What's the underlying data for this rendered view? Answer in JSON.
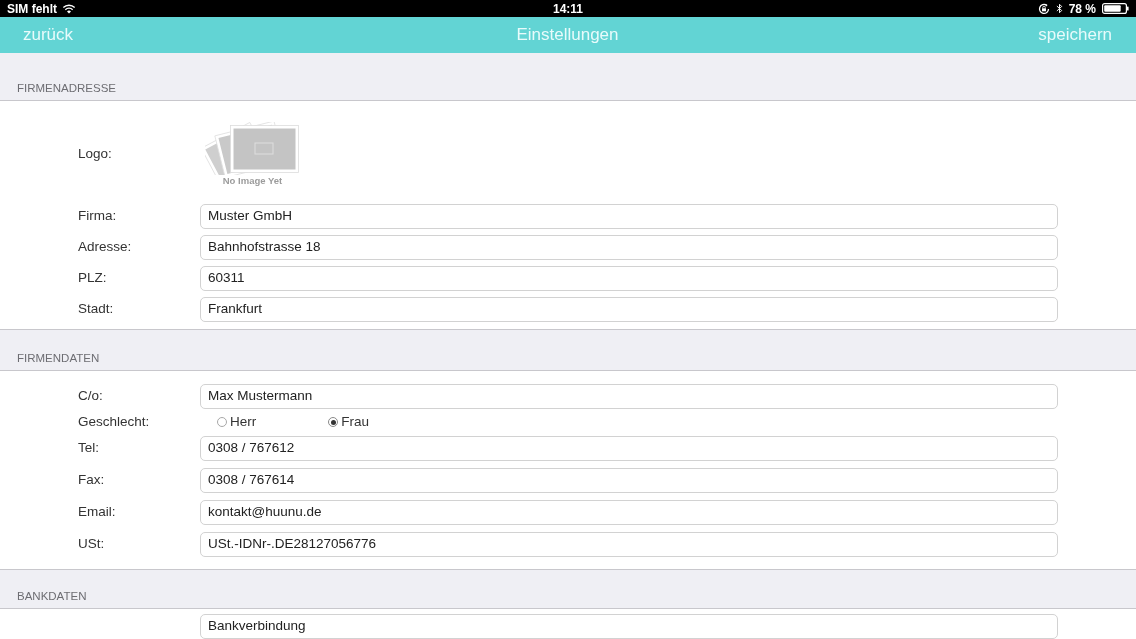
{
  "status_bar": {
    "carrier": "SIM fehlt",
    "time": "14:11",
    "battery": "78 %"
  },
  "nav_bar": {
    "back": "zurück",
    "title": "Einstellungen",
    "save": "speichern"
  },
  "sections": [
    {
      "title": "FIRMENADRESSE",
      "rows": [
        {
          "kind": "image",
          "label": "Logo:",
          "caption": "No Image Yet"
        },
        {
          "kind": "field",
          "label": "Firma:",
          "value": "Muster GmbH"
        },
        {
          "kind": "field",
          "label": "Adresse:",
          "value": "Bahnhofstrasse 18"
        },
        {
          "kind": "field",
          "label": "PLZ:",
          "value": "60311"
        },
        {
          "kind": "field",
          "label": "Stadt:",
          "value": "Frankfurt"
        }
      ]
    },
    {
      "title": "FIRMENDATEN",
      "rows": [
        {
          "kind": "field",
          "label": "C/o:",
          "value": "Max Mustermann"
        },
        {
          "kind": "radio",
          "label": "Geschlecht:",
          "options": [
            {
              "label": "Herr",
              "selected": false
            },
            {
              "label": "Frau",
              "selected": true
            }
          ]
        },
        {
          "kind": "field",
          "label": "Tel:",
          "value": "0308 / 767612"
        },
        {
          "kind": "field",
          "label": "Fax:",
          "value": "0308 / 767614"
        },
        {
          "kind": "field",
          "label": "Email:",
          "value": "kontakt@huunu.de"
        },
        {
          "kind": "field",
          "label": "USt:",
          "value": "USt.-IDNr-.DE28127056776"
        }
      ]
    },
    {
      "title": "BANKDATEN",
      "rows": [
        {
          "kind": "field",
          "value": "Bankverbindung"
        }
      ]
    }
  ]
}
